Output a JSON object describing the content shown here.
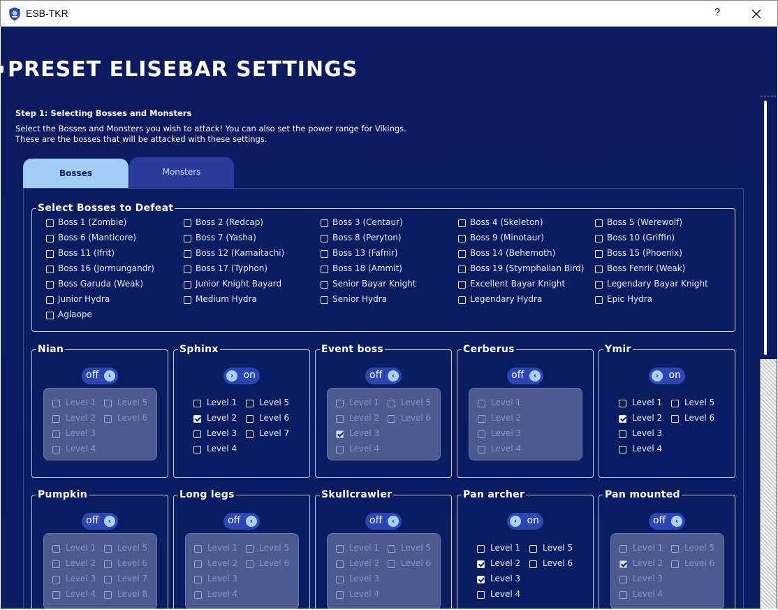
{
  "window": {
    "title": "ESB-TKR",
    "help_label": "?"
  },
  "page": {
    "title": "PRESET ELISEBAR SETTINGS",
    "step_heading": "Step 1: Selecting Bosses and Monsters",
    "step_desc_line1": "Select the Bosses and Monsters you wish to attack! You can also set the power range for Vikings.",
    "step_desc_line2": "These are the bosses that will be attacked with these settings."
  },
  "tabs": [
    {
      "label": "Bosses",
      "active": true
    },
    {
      "label": "Monsters",
      "active": false
    }
  ],
  "bosses_group": {
    "legend": "Select Bosses to Defeat",
    "items": [
      "Boss 1 (Zombie)",
      "Boss 2 (Redcap)",
      "Boss 3 (Centaur)",
      "Boss 4 (Skeleton)",
      "Boss 5 (Werewolf)",
      "Boss 6 (Manticore)",
      "Boss 7 (Yasha)",
      "Boss 8 (Peryton)",
      "Boss 9 (Minotaur)",
      "Boss 10 (Griffin)",
      "Boss 11 (Ifrit)",
      "Boss 12 (Kamaitachi)",
      "Boss 13 (Fafnir)",
      "Boss 14 (Behemoth)",
      "Boss 15 (Phoenix)",
      "Boss 16 (Jormungandr)",
      "Boss 17 (Typhon)",
      "Boss 18 (Ammit)",
      "Boss 19 (Stymphalian Bird)",
      "Boss Fenrir (Weak)",
      "Boss Garuda (Weak)",
      "Junior Knight Bayard",
      "Senior Bayar Knight",
      "Excellent Bayar Knight",
      "Legendary Bayar Knight",
      "Junior Hydra",
      "Medium Hydra",
      "Senior Hydra",
      "Legendary Hydra",
      "Epic Hydra",
      "Aglaope"
    ]
  },
  "boss_panels": [
    {
      "name": "Nian",
      "toggle": "off",
      "levels": [
        "Level 1",
        "Level 2",
        "Level 3",
        "Level 4",
        "Level 5",
        "Level 6"
      ],
      "checked": []
    },
    {
      "name": "Sphinx",
      "toggle": "on",
      "levels": [
        "Level 1",
        "Level 2",
        "Level 3",
        "Level 4",
        "Level 5",
        "Level 6",
        "Level 7"
      ],
      "checked": [
        "Level 2"
      ]
    },
    {
      "name": "Event boss",
      "toggle": "off",
      "levels": [
        "Level 1",
        "Level 2",
        "Level 3",
        "Level 4",
        "Level 5",
        "Level 6"
      ],
      "checked": [
        "Level 3"
      ]
    },
    {
      "name": "Cerberus",
      "toggle": "off",
      "levels": [
        "Level 1",
        "Level 2",
        "Level 3",
        "Level 4"
      ],
      "checked": []
    },
    {
      "name": "Ymir",
      "toggle": "on",
      "levels": [
        "Level 1",
        "Level 2",
        "Level 3",
        "Level 4",
        "Level 5",
        "Level 6"
      ],
      "checked": [
        "Level 2"
      ]
    },
    {
      "name": "Pumpkin",
      "toggle": "off",
      "levels": [
        "Level 1",
        "Level 2",
        "Level 3",
        "Level 4",
        "Level 5",
        "Level 6",
        "Level 7",
        "Level 8"
      ],
      "checked": []
    },
    {
      "name": "Long legs",
      "toggle": "off",
      "levels": [
        "Level 1",
        "Level 2",
        "Level 3",
        "Level 4",
        "Level 5",
        "Level 6"
      ],
      "checked": []
    },
    {
      "name": "Skullcrawler",
      "toggle": "off",
      "levels": [
        "Level 1",
        "Level 2",
        "Level 3",
        "Level 4",
        "Level 5",
        "Level 6"
      ],
      "checked": []
    },
    {
      "name": "Pan archer",
      "toggle": "on",
      "levels": [
        "Level 1",
        "Level 2",
        "Level 3",
        "Level 4",
        "Level 5",
        "Level 6"
      ],
      "checked": [
        "Level 2",
        "Level 3"
      ]
    },
    {
      "name": "Pan mounted",
      "toggle": "off",
      "levels": [
        "Level 1",
        "Level 2",
        "Level 3",
        "Level 4",
        "Level 5",
        "Level 6"
      ],
      "checked": [
        "Level 2"
      ]
    }
  ],
  "toggle_labels": {
    "on": "on",
    "off": "off"
  },
  "colors": {
    "background": "#0b1c5e",
    "tab_active": "#9fcdf6",
    "tab_inactive": "#2b3a9b",
    "toggle": "#2d46b5",
    "toggle_knob": "#a9d2f8",
    "disabled_box": "#4d5a8f"
  }
}
